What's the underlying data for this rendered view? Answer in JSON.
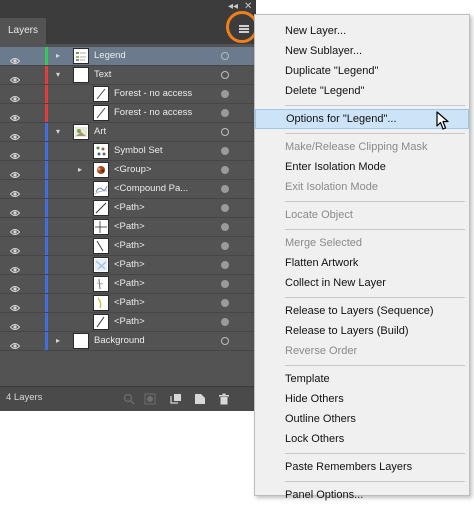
{
  "panel": {
    "tab_label": "Layers",
    "collapse_glyph": "◂◂",
    "close_glyph": "✕",
    "footer_count": "4 Layers",
    "colors": {
      "accent_ring": "#f07f1a",
      "selected_row": "#6b7a8c"
    }
  },
  "rows": [
    {
      "label": "Legend",
      "indent": 0,
      "expand": "▸",
      "bar": "#34c759",
      "thumb": "legend",
      "selected": true,
      "target": "hollow"
    },
    {
      "label": "Text",
      "indent": 0,
      "expand": "▾",
      "bar": "#e23c3c",
      "thumb": "blank",
      "target": "hollow"
    },
    {
      "label": "Forest - no access",
      "indent": 2,
      "expand": "",
      "bar": "#e23c3c",
      "thumb": "line",
      "target": "filled"
    },
    {
      "label": "Forest - no access",
      "indent": 2,
      "expand": "",
      "bar": "#e23c3c",
      "thumb": "line",
      "target": "filled"
    },
    {
      "label": "Art",
      "indent": 0,
      "expand": "▾",
      "bar": "#3f6fe0",
      "thumb": "art",
      "target": "hollow"
    },
    {
      "label": "Symbol Set",
      "indent": 1,
      "expand": "",
      "bar": "#3f6fe0",
      "thumb": "symbols",
      "target": "filled"
    },
    {
      "label": "<Group>",
      "indent": 1,
      "expand": "▸",
      "bar": "#3f6fe0",
      "thumb": "group",
      "target": "filled"
    },
    {
      "label": "<Compound Pa...",
      "indent": 1,
      "expand": "",
      "bar": "#3f6fe0",
      "thumb": "compound",
      "target": "filled"
    },
    {
      "label": "<Path>",
      "indent": 1,
      "expand": "",
      "bar": "#3f6fe0",
      "thumb": "path1",
      "target": "filled"
    },
    {
      "label": "<Path>",
      "indent": 1,
      "expand": "",
      "bar": "#3f6fe0",
      "thumb": "path2",
      "target": "filled"
    },
    {
      "label": "<Path>",
      "indent": 1,
      "expand": "",
      "bar": "#3f6fe0",
      "thumb": "path3",
      "target": "filled"
    },
    {
      "label": "<Path>",
      "indent": 1,
      "expand": "",
      "bar": "#3f6fe0",
      "thumb": "path4",
      "target": "filled"
    },
    {
      "label": "<Path>",
      "indent": 1,
      "expand": "",
      "bar": "#3f6fe0",
      "thumb": "path5",
      "target": "filled"
    },
    {
      "label": "<Path>",
      "indent": 1,
      "expand": "",
      "bar": "#3f6fe0",
      "thumb": "path6",
      "target": "filled"
    },
    {
      "label": "<Path>",
      "indent": 1,
      "expand": "",
      "bar": "#3f6fe0",
      "thumb": "path7",
      "target": "filled"
    },
    {
      "label": "Background",
      "indent": 0,
      "expand": "▸",
      "bar": "#3f6fe0",
      "thumb": "blank",
      "target": "hollow"
    }
  ],
  "footer_icons": [
    "locate-object-icon",
    "make-clipping-mask-icon",
    "create-sublayer-icon",
    "create-new-layer-icon",
    "delete-icon"
  ],
  "menu": {
    "groups": [
      [
        {
          "label": "New Layer...",
          "enabled": true
        },
        {
          "label": "New Sublayer...",
          "enabled": true
        },
        {
          "label": "Duplicate \"Legend\"",
          "enabled": true
        },
        {
          "label": "Delete \"Legend\"",
          "enabled": true
        }
      ],
      [
        {
          "label": "Options for \"Legend\"...",
          "enabled": true,
          "hover": true
        }
      ],
      [
        {
          "label": "Make/Release Clipping Mask",
          "enabled": false
        },
        {
          "label": "Enter Isolation Mode",
          "enabled": true
        },
        {
          "label": "Exit Isolation Mode",
          "enabled": false
        }
      ],
      [
        {
          "label": "Locate Object",
          "enabled": false
        }
      ],
      [
        {
          "label": "Merge Selected",
          "enabled": false
        },
        {
          "label": "Flatten Artwork",
          "enabled": true
        },
        {
          "label": "Collect in New Layer",
          "enabled": true
        }
      ],
      [
        {
          "label": "Release to Layers (Sequence)",
          "enabled": true
        },
        {
          "label": "Release to Layers (Build)",
          "enabled": true
        },
        {
          "label": "Reverse Order",
          "enabled": false
        }
      ],
      [
        {
          "label": "Template",
          "enabled": true
        },
        {
          "label": "Hide Others",
          "enabled": true
        },
        {
          "label": "Outline Others",
          "enabled": true
        },
        {
          "label": "Lock Others",
          "enabled": true
        }
      ],
      [
        {
          "label": "Paste Remembers Layers",
          "enabled": true
        }
      ],
      [
        {
          "label": "Panel Options...",
          "enabled": true
        }
      ]
    ]
  }
}
